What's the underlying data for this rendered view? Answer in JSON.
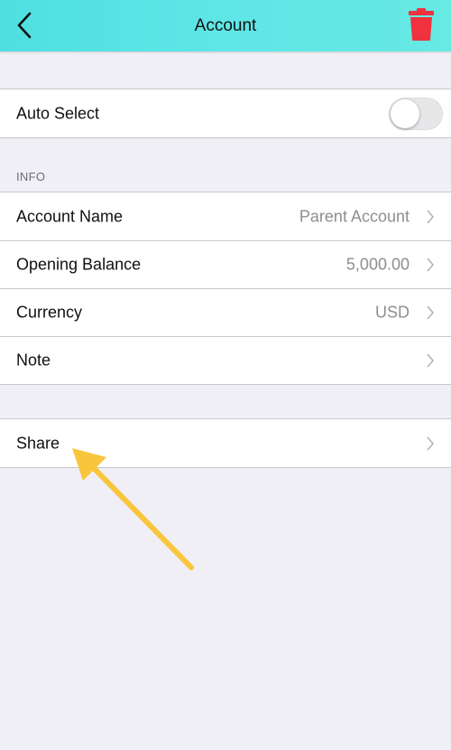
{
  "header": {
    "title": "Account",
    "back_icon": "chevron-left-icon",
    "delete_icon": "trash-icon",
    "accent_color": "#5fe6e6",
    "delete_color": "#f0313e"
  },
  "auto_select": {
    "label": "Auto Select",
    "toggle_on": false
  },
  "info_section": {
    "header": "INFO",
    "rows": [
      {
        "label": "Account Name",
        "value": "Parent Account"
      },
      {
        "label": "Opening Balance",
        "value": "5,000.00"
      },
      {
        "label": "Currency",
        "value": "USD"
      },
      {
        "label": "Note",
        "value": ""
      }
    ]
  },
  "share": {
    "label": "Share"
  },
  "annotation": {
    "arrow_color": "#f9c53c"
  }
}
